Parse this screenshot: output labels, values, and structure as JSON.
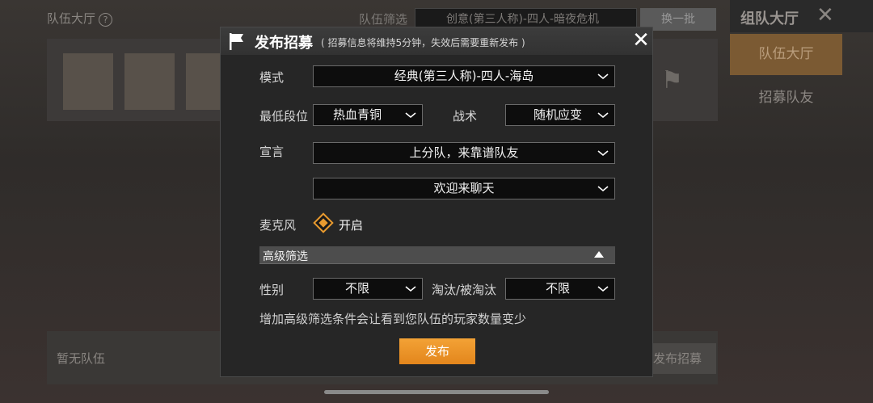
{
  "background": {
    "lobby_title": "队伍大厅",
    "help_icon": "?",
    "filter_label": "队伍筛选",
    "filter_value": "创意(第三人称)-四人-暗夜危机",
    "refresh_button": "换一批",
    "right_panel_title": "组队大厅",
    "right_tabs": [
      "队伍大厅",
      "招募队友"
    ],
    "empty_text": "暂无队伍",
    "post_recruit_button": "发布招募"
  },
  "modal": {
    "title": "发布招募",
    "subtitle": "( 招募信息将维持5分钟，失效后需要重新发布 )",
    "close_icon": "close-icon",
    "mode": {
      "label": "模式",
      "value": "经典(第三人称)-四人-海岛"
    },
    "min_rank": {
      "label": "最低段位",
      "value": "热血青铜"
    },
    "tactic": {
      "label": "战术",
      "value": "随机应变"
    },
    "declaration": {
      "label": "宣言",
      "value1": "上分队，来靠谱队友",
      "value2": "欢迎来聊天"
    },
    "mic": {
      "label": "麦克风",
      "value": "开启",
      "checked": true
    },
    "advanced": {
      "label": "高级筛选",
      "gender": {
        "label": "性别",
        "value": "不限"
      },
      "elimination": {
        "label": "淘汰/被淘汰",
        "value": "不限"
      },
      "hint": "增加高级筛选条件会让看到您队伍的玩家数量变少"
    },
    "publish_button": "发布"
  },
  "colors": {
    "accent": "#e89a2f",
    "modal_bg": "#262626",
    "select_bg": "#0d0d0d"
  }
}
